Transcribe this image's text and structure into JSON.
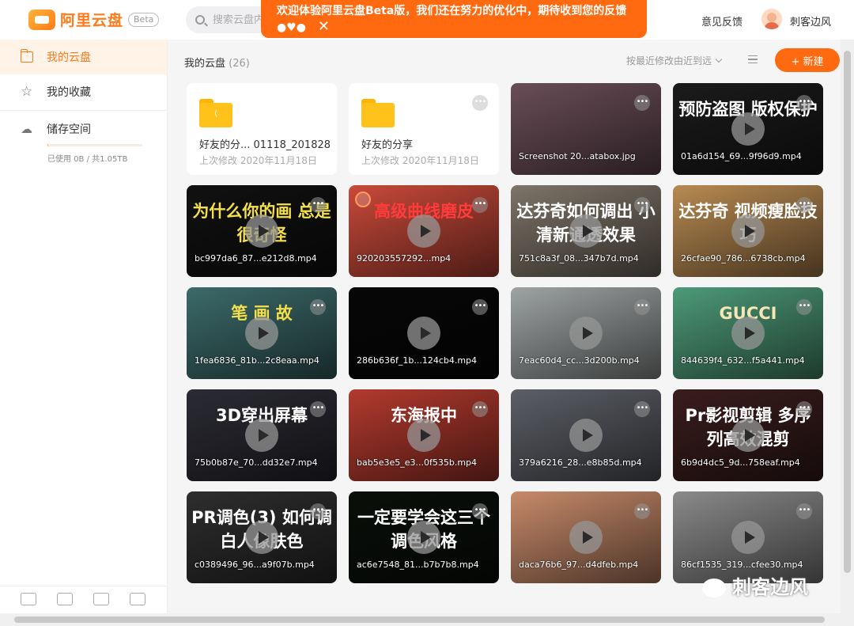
{
  "app": {
    "logo_text": "阿里云盘",
    "beta_label": "Beta",
    "search_placeholder": "搜索云盘内",
    "banner_text": "欢迎体验阿里云盘Beta版，我们还在努力的优化中，期待收到您的反馈●♥●",
    "banner_close": "✕",
    "feedback_label": "意见反馈",
    "username": "刺客边风"
  },
  "sidebar": {
    "items": [
      {
        "label": "我的云盘",
        "icon": "folder-icon",
        "active": true
      },
      {
        "label": "我的收藏",
        "icon": "star-icon",
        "active": false
      },
      {
        "label": "储存空间",
        "icon": "cloud-icon",
        "active": false
      }
    ],
    "usage_text": "已使用 0B / 共1.05TB",
    "usage_fraction": 0.0
  },
  "main": {
    "title": "我的云盘",
    "count": "(26)",
    "sort_label": "按最近修改由近到远",
    "new_button": "+ 新建"
  },
  "folders": [
    {
      "name": "好友的分... 01118_201828",
      "date": "上次修改 2020年11月18日"
    },
    {
      "name": "好友的分享",
      "date": "上次修改 2020年11月18日"
    }
  ],
  "files": [
    {
      "name": "Screenshot 20...atabox.jpg",
      "overlay": "",
      "bg": "#6a4e57",
      "overlay_color": "#fff"
    },
    {
      "name": "01a6d154_69...9f96d9.mp4",
      "overlay": "预防盗图 版权保护",
      "bg": "#1b1b1b",
      "overlay_color": "#fff"
    },
    {
      "name": "bc997da6_87...e212d8.mp4",
      "overlay": "为什么你的画 总是很奇怪",
      "bg": "#111",
      "overlay_color": "#f5e04a"
    },
    {
      "name": "920203557292...mp4",
      "overlay": "高级曲线磨皮",
      "bg": "#c94a3a",
      "overlay_color": "#ff3b3b"
    },
    {
      "name": "751c8a3f_08...347b7d.mp4",
      "overlay": "达芬奇如何调出 小清新通透效果",
      "bg": "#7e7468",
      "overlay_color": "#fff"
    },
    {
      "name": "26cfae90_786...6738cb.mp4",
      "overlay": "达芬奇 视频瘦脸技巧",
      "bg": "#b88a52",
      "overlay_color": "#fff"
    },
    {
      "name": "1fea6836_81b...2c8eaa.mp4",
      "overlay": "笔 画 故",
      "bg": "#3c6a6a",
      "overlay_color": "#f5e04a"
    },
    {
      "name": "286b636f_1b...124cb4.mp4",
      "overlay": "",
      "bg": "#070707",
      "overlay_color": "#fff"
    },
    {
      "name": "7eac60d4_cc...3d200b.mp4",
      "overlay": "",
      "bg": "#9ea3a3",
      "overlay_color": "#fff"
    },
    {
      "name": "844639f4_632...f5a441.mp4",
      "overlay": "GUCCI",
      "bg": "#4d9a78",
      "overlay_color": "#f5e6b5"
    },
    {
      "name": "75b0b87e_70...dd32e7.mp4",
      "overlay": "3D穿出屏幕",
      "bg": "#2b2b33",
      "overlay_color": "#fff"
    },
    {
      "name": "bab5e3e5_e3...0f535b.mp4",
      "overlay": "东海报中",
      "bg": "#b33a2e",
      "overlay_color": "#fff"
    },
    {
      "name": "379a6216_28...e8b85d.mp4",
      "overlay": "",
      "bg": "#5c5f66",
      "overlay_color": "#fff"
    },
    {
      "name": "6b9d4dc5_9d...758eaf.mp4",
      "overlay": "Pr影视剪辑 多序列高效混剪",
      "bg": "#3a1d1d",
      "overlay_color": "#fff"
    },
    {
      "name": "c0389496_96...a9f07b.mp4",
      "overlay": "PR调色(3) 如何调白人像肤色",
      "bg": "#2e2e2e",
      "overlay_color": "#fff"
    },
    {
      "name": "ac6e7548_81...b7b7b8.mp4",
      "overlay": "一定要学会这三个调色风格",
      "bg": "#0a0f0a",
      "overlay_color": "#fff"
    },
    {
      "name": "daca76b6_97...d4dfeb.mp4",
      "overlay": "",
      "bg": "#c78a6a",
      "overlay_color": "#fff"
    },
    {
      "name": "86cf1535_319...cfee30.mp4",
      "overlay": "",
      "bg": "#8a8a8a",
      "overlay_color": "#fff"
    }
  ],
  "watermark": "刺客边风",
  "colors": {
    "accent": "#ff6a10",
    "sidebar_active_bg": "#fff3e8",
    "folder": "#ffc21a"
  }
}
